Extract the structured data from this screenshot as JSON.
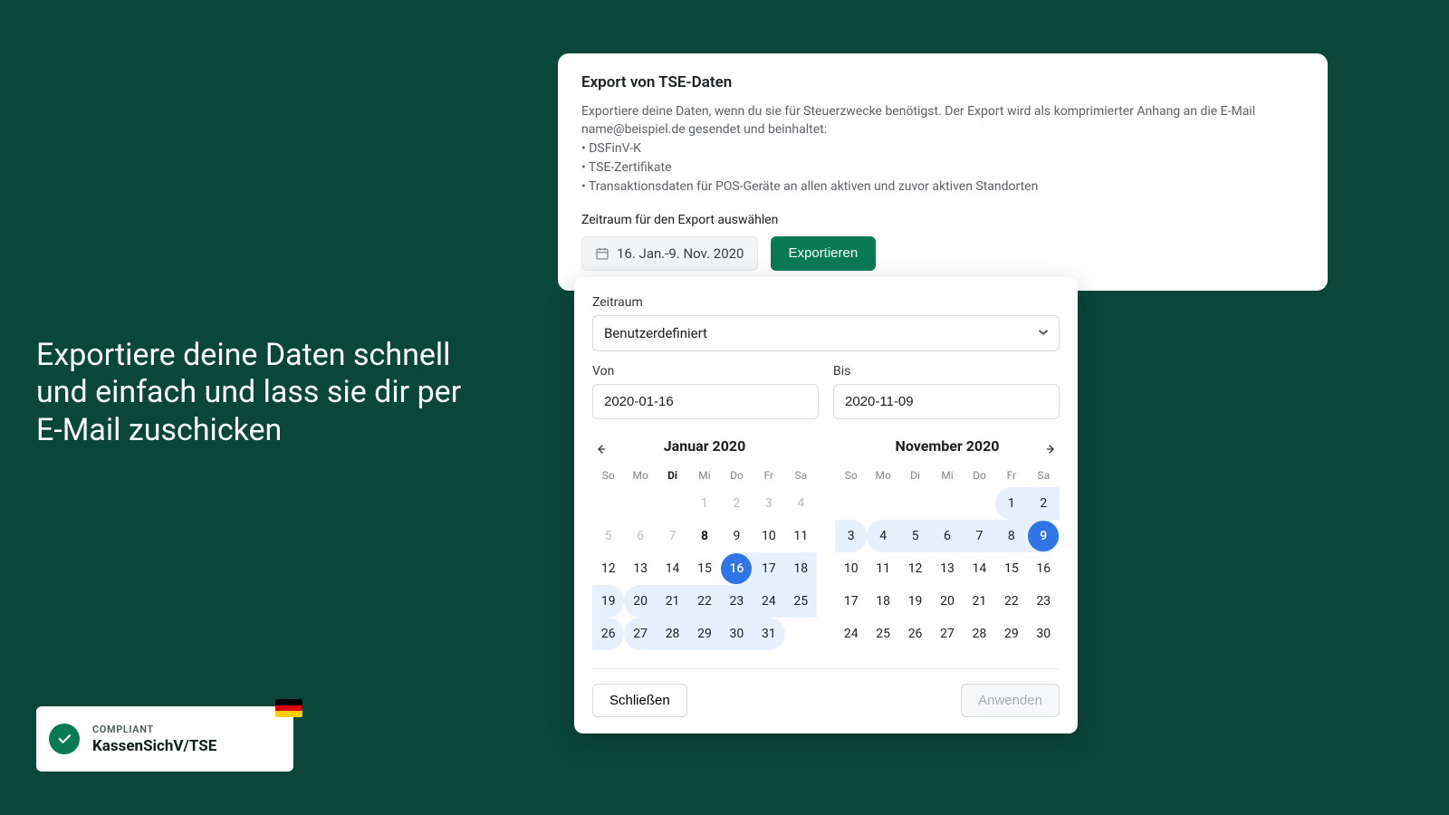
{
  "hero": "Exportiere deine Daten schnell und einfach und lass sie dir per E-Mail zuschicken",
  "compliance": {
    "small": "COMPLIANT",
    "large": "KassenSichV/TSE"
  },
  "card": {
    "title": "Export von TSE-Daten",
    "desc": "Exportiere deine Daten, wenn du sie für Steuerzwecke benötigst. Der Export wird als komprimierter Anhang an die E-Mail name@beispiel.de gesendet und beinhaltet:",
    "bullets": [
      "DSFinV-K",
      "TSE-Zertifikate",
      "Transaktionsdaten für POS-Geräte an allen aktiven und zuvor aktiven Standorten"
    ],
    "subhead": "Zeitraum für den Export auswählen",
    "range_label": "16. Jan.-9. Nov. 2020",
    "export_label": "Exportieren"
  },
  "picker": {
    "zeitraum_label": "Zeitraum",
    "select_value": "Benutzerdefiniert",
    "from_label": "Von",
    "to_label": "Bis",
    "from_value": "2020-01-16",
    "to_value": "2020-11-09",
    "month_a": "Januar 2020",
    "month_b": "November 2020",
    "dows": [
      "So",
      "Mo",
      "Di",
      "Mi",
      "Do",
      "Fr",
      "Sa"
    ],
    "close": "Schließen",
    "apply": "Anwenden"
  },
  "cal_a": {
    "today_dow_index": 2,
    "rows": [
      [
        null,
        null,
        null,
        {
          "n": 1,
          "m": true
        },
        {
          "n": 2,
          "m": true
        },
        {
          "n": 3,
          "m": true
        },
        {
          "n": 4,
          "m": true
        }
      ],
      [
        {
          "n": 5,
          "m": true
        },
        {
          "n": 6,
          "m": true
        },
        {
          "n": 7,
          "m": true
        },
        {
          "n": 8,
          "b": true
        },
        {
          "n": 9
        },
        {
          "n": 10
        },
        {
          "n": 11
        }
      ],
      [
        {
          "n": 12
        },
        {
          "n": 13
        },
        {
          "n": 14
        },
        {
          "n": 15
        },
        {
          "n": 16,
          "sel": true,
          "rstart": true
        },
        {
          "n": 17,
          "r": true
        },
        {
          "n": 18,
          "r": true
        }
      ],
      [
        {
          "n": 19,
          "r": true,
          "rend": true
        },
        {
          "n": 20,
          "r": true,
          "rstart": true
        },
        {
          "n": 21,
          "r": true
        },
        {
          "n": 22,
          "r": true
        },
        {
          "n": 23,
          "r": true
        },
        {
          "n": 24,
          "r": true
        },
        {
          "n": 25,
          "r": true
        }
      ],
      [
        {
          "n": 26,
          "r": true,
          "rend": true
        },
        {
          "n": 27,
          "r": true,
          "rstart": true
        },
        {
          "n": 28,
          "r": true
        },
        {
          "n": 29,
          "r": true
        },
        {
          "n": 30,
          "r": true
        },
        {
          "n": 31,
          "r": true,
          "rend": true
        },
        null
      ]
    ]
  },
  "cal_b": {
    "rows": [
      [
        null,
        null,
        null,
        null,
        null,
        {
          "n": 1,
          "r": true,
          "rstart": true
        },
        {
          "n": 2,
          "r": true
        }
      ],
      [
        {
          "n": 3,
          "r": true,
          "rend": true
        },
        {
          "n": 4,
          "r": true,
          "rstart": true
        },
        {
          "n": 5,
          "r": true
        },
        {
          "n": 6,
          "r": true
        },
        {
          "n": 7,
          "r": true
        },
        {
          "n": 8,
          "r": true
        },
        {
          "n": 9,
          "sel": true,
          "rend": true
        }
      ],
      [
        {
          "n": 10
        },
        {
          "n": 11
        },
        {
          "n": 12
        },
        {
          "n": 13
        },
        {
          "n": 14
        },
        {
          "n": 15
        },
        {
          "n": 16
        }
      ],
      [
        {
          "n": 17
        },
        {
          "n": 18
        },
        {
          "n": 19
        },
        {
          "n": 20
        },
        {
          "n": 21
        },
        {
          "n": 22
        },
        {
          "n": 23
        }
      ],
      [
        {
          "n": 24
        },
        {
          "n": 25
        },
        {
          "n": 26
        },
        {
          "n": 27
        },
        {
          "n": 28
        },
        {
          "n": 29
        },
        {
          "n": 30
        }
      ]
    ]
  }
}
